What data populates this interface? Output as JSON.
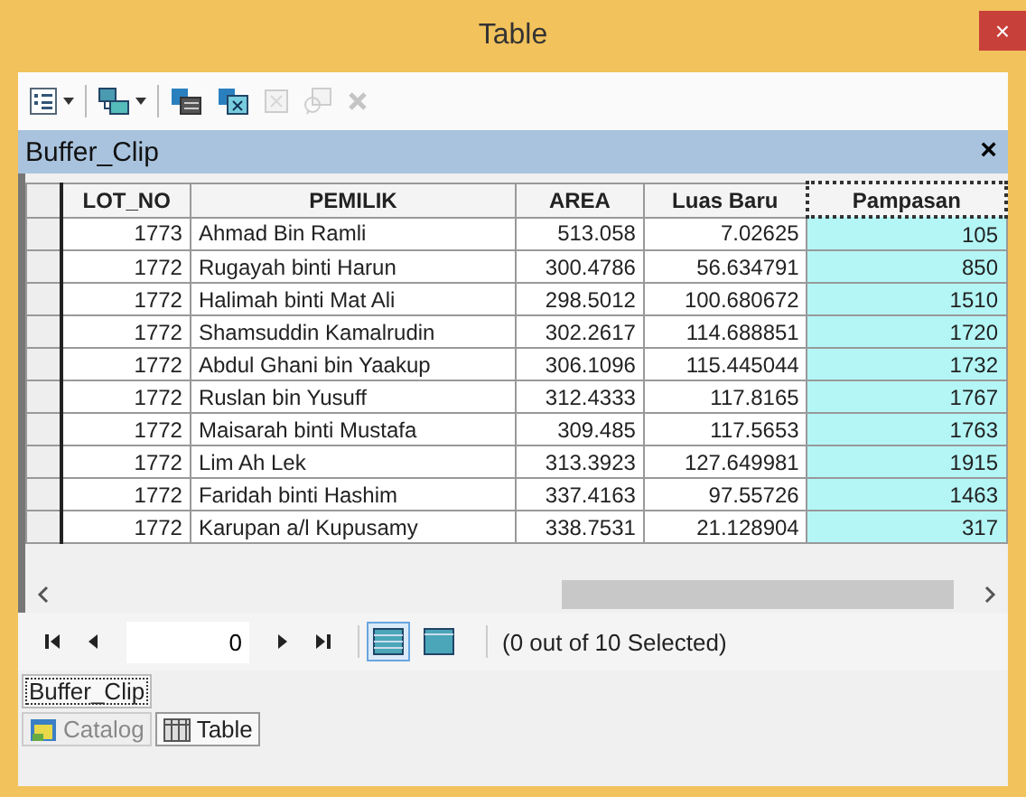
{
  "window": {
    "title": "Table",
    "close": "×"
  },
  "toolbar": [
    {
      "kind": "options",
      "dropdown": true,
      "disabled": false
    },
    {
      "kind": "relate",
      "dropdown": true,
      "disabled": false
    },
    {
      "kind": "select-by",
      "dropdown": false,
      "disabled": false
    },
    {
      "kind": "switch",
      "dropdown": false,
      "disabled": false
    },
    {
      "kind": "clear",
      "dropdown": false,
      "disabled": true
    },
    {
      "kind": "zoom",
      "dropdown": false,
      "disabled": true
    },
    {
      "kind": "delete",
      "dropdown": false,
      "disabled": true
    }
  ],
  "panel": {
    "title": "Buffer_Clip",
    "close": "×"
  },
  "table": {
    "columns": [
      {
        "label": "LOT_NO",
        "selected": false
      },
      {
        "label": "PEMILIK",
        "selected": false
      },
      {
        "label": "AREA",
        "selected": false
      },
      {
        "label": "Luas Baru",
        "selected": false
      },
      {
        "label": "Pampasan",
        "selected": true
      }
    ],
    "rows": [
      [
        "1773",
        "Ahmad Bin Ramli",
        "513.058",
        "7.02625",
        "105"
      ],
      [
        "1772",
        "Rugayah binti Harun",
        "300.4786",
        "56.634791",
        "850"
      ],
      [
        "1772",
        "Halimah binti Mat Ali",
        "298.5012",
        "100.680672",
        "1510"
      ],
      [
        "1772",
        "Shamsuddin Kamalrudin",
        "302.2617",
        "114.688851",
        "1720"
      ],
      [
        "1772",
        "Abdul Ghani bin Yaakup",
        "306.1096",
        "115.445044",
        "1732"
      ],
      [
        "1772",
        "Ruslan bin Yusuff",
        "312.4333",
        "117.8165",
        "1767"
      ],
      [
        "1772",
        "Maisarah binti Mustafa",
        "309.485",
        "117.5653",
        "1763"
      ],
      [
        "1772",
        "Lim Ah Lek",
        "313.3923",
        "127.649981",
        "1915"
      ],
      [
        "1772",
        "Faridah binti Hashim",
        "337.4163",
        "97.55726",
        "1463"
      ],
      [
        "1772",
        "Karupan a/l Kupusamy",
        "338.7531",
        "21.128904",
        "317"
      ]
    ]
  },
  "navigator": {
    "record": "0",
    "views": [
      {
        "kind": "all",
        "selected": true
      },
      {
        "kind": "selected",
        "selected": false
      }
    ],
    "status": "(0 out of 10 Selected)"
  },
  "table_tabs": [
    {
      "label": "Buffer_Clip",
      "selected": true
    }
  ],
  "dock_tabs": [
    {
      "label": "Catalog",
      "kind": "catalog",
      "selected": false
    },
    {
      "label": "Table",
      "kind": "table",
      "selected": true
    }
  ]
}
